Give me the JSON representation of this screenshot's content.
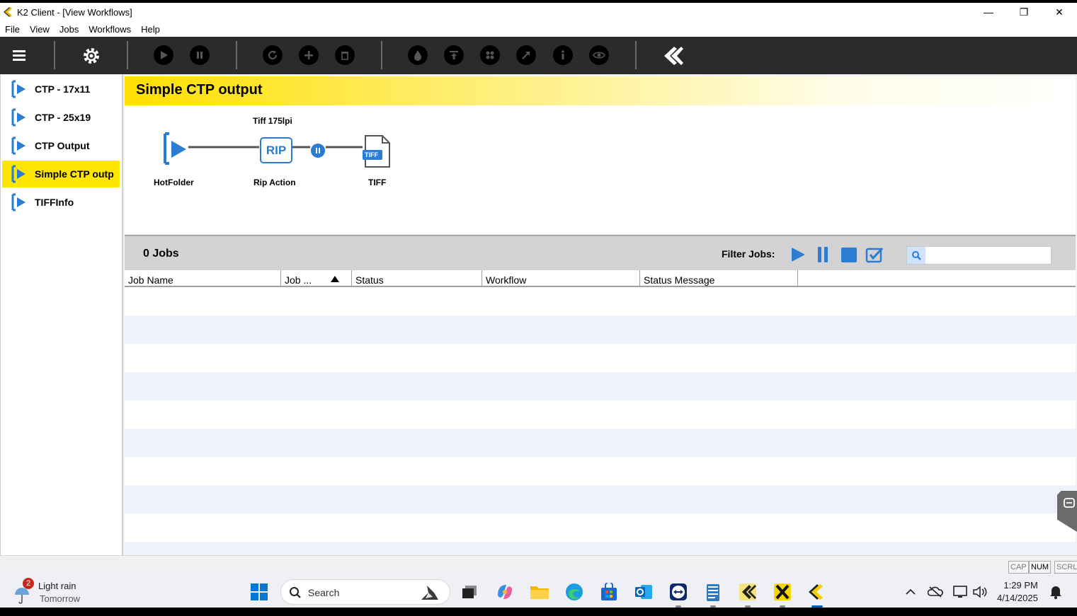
{
  "window": {
    "title": "K2 Client - [View Workflows]",
    "controls": {
      "minimize": "—",
      "restore": "❐",
      "close": "✕"
    }
  },
  "menu": [
    "File",
    "View",
    "Jobs",
    "Workflows",
    "Help"
  ],
  "toolbar": {
    "icons": [
      "menu-icon",
      "gear-icon",
      "play-icon",
      "pause-icon",
      "refresh-icon",
      "add-icon",
      "delete-icon",
      "ink-drop-icon",
      "output-icon",
      "grid-icon",
      "move-icon",
      "info-icon",
      "preview-icon",
      "k2-logo"
    ]
  },
  "workflows": [
    {
      "label": "CTP - 17x11",
      "selected": false
    },
    {
      "label": "CTP - 25x19",
      "selected": false
    },
    {
      "label": "CTP Output",
      "selected": false
    },
    {
      "label": "Simple CTP outp",
      "selected": true
    },
    {
      "label": "TIFFInfo",
      "selected": false
    }
  ],
  "workflow_view": {
    "title": "Simple CTP output",
    "nodes": {
      "hotfolder": "HotFolder",
      "rip_action": "Rip Action",
      "rip_badge": "RIP",
      "rip_setting": "Tiff 175lpi",
      "tiff": "TIFF",
      "tiff_badge": "TIFF"
    }
  },
  "jobs": {
    "count_label": "0 Jobs",
    "filter_label": "Filter Jobs:",
    "search_placeholder": "",
    "columns": [
      "Job Name",
      "Job ...",
      "Status",
      "Workflow",
      "Status Message"
    ],
    "sorted_column": "Job ...",
    "sort_direction": "ascending",
    "rows": []
  },
  "indicators": {
    "cap": "CAP",
    "num": "NUM",
    "scrl": "SCRL"
  },
  "taskbar": {
    "weather_badge": "2",
    "weather_line1": "Light rain",
    "weather_line2": "Tomorrow",
    "search_label": "Search",
    "time": "1:29 PM",
    "date": "4/14/2025"
  },
  "colors": {
    "accent_yellow": "#ffe600",
    "toolbar_bg": "#2b2b2b",
    "workflow_blue": "#2b7cd3"
  }
}
